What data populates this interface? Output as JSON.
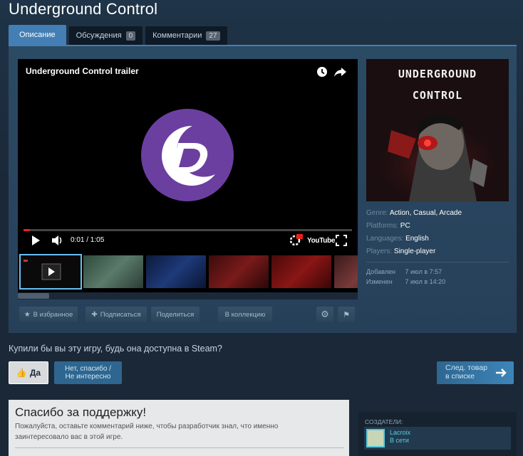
{
  "page": {
    "title": "Underground Control"
  },
  "tabs": [
    {
      "label": "Описание",
      "count": null
    },
    {
      "label": "Обсуждения",
      "count": "0"
    },
    {
      "label": "Комментарии",
      "count": "27"
    }
  ],
  "video": {
    "title": "Underground Control trailer",
    "time": "0:01 / 1:05",
    "youtube_label": "YouTube",
    "progress_fraction": 0.02
  },
  "capsule": {
    "line1": "UNDERGROUND",
    "line2": "CONTROL"
  },
  "meta": {
    "genre_key": "Genre:",
    "genre_values": [
      "Action",
      "Casual",
      "Arcade"
    ],
    "platforms_key": "Platforms:",
    "platforms_value": "PC",
    "languages_key": "Languages:",
    "languages_value": "English",
    "players_key": "Players:",
    "players_value": "Single-player",
    "added_key": "Добавлен",
    "added_value": "7 июл в 7:57",
    "changed_key": "Изменен",
    "changed_value": "7 июл в 14:20"
  },
  "actions": {
    "favorite": "В избранное",
    "subscribe": "Подписаться",
    "share": "Поделиться",
    "collection": "В коллекцию"
  },
  "vote": {
    "question": "Купили бы вы эту игру, будь она доступна в Steam?",
    "yes": "Да",
    "no_line1": "Нет, спасибо /",
    "no_line2": "Не интересно",
    "next_line1": "След. товар",
    "next_line2": "в списке"
  },
  "thanks": {
    "title": "Спасибо за поддержку!",
    "text": "Пожалуйста, оставьте комментарий ниже, чтобы разработчик знал, что именно заинтересовало вас в этой игре."
  },
  "creators": {
    "label": "СОЗДАТЕЛИ:",
    "name": "Lacroix",
    "status": "В сети"
  },
  "colors": {
    "accent": "#437fb4",
    "brand_purple": "#6b3fa0",
    "link": "#66c0f4"
  }
}
